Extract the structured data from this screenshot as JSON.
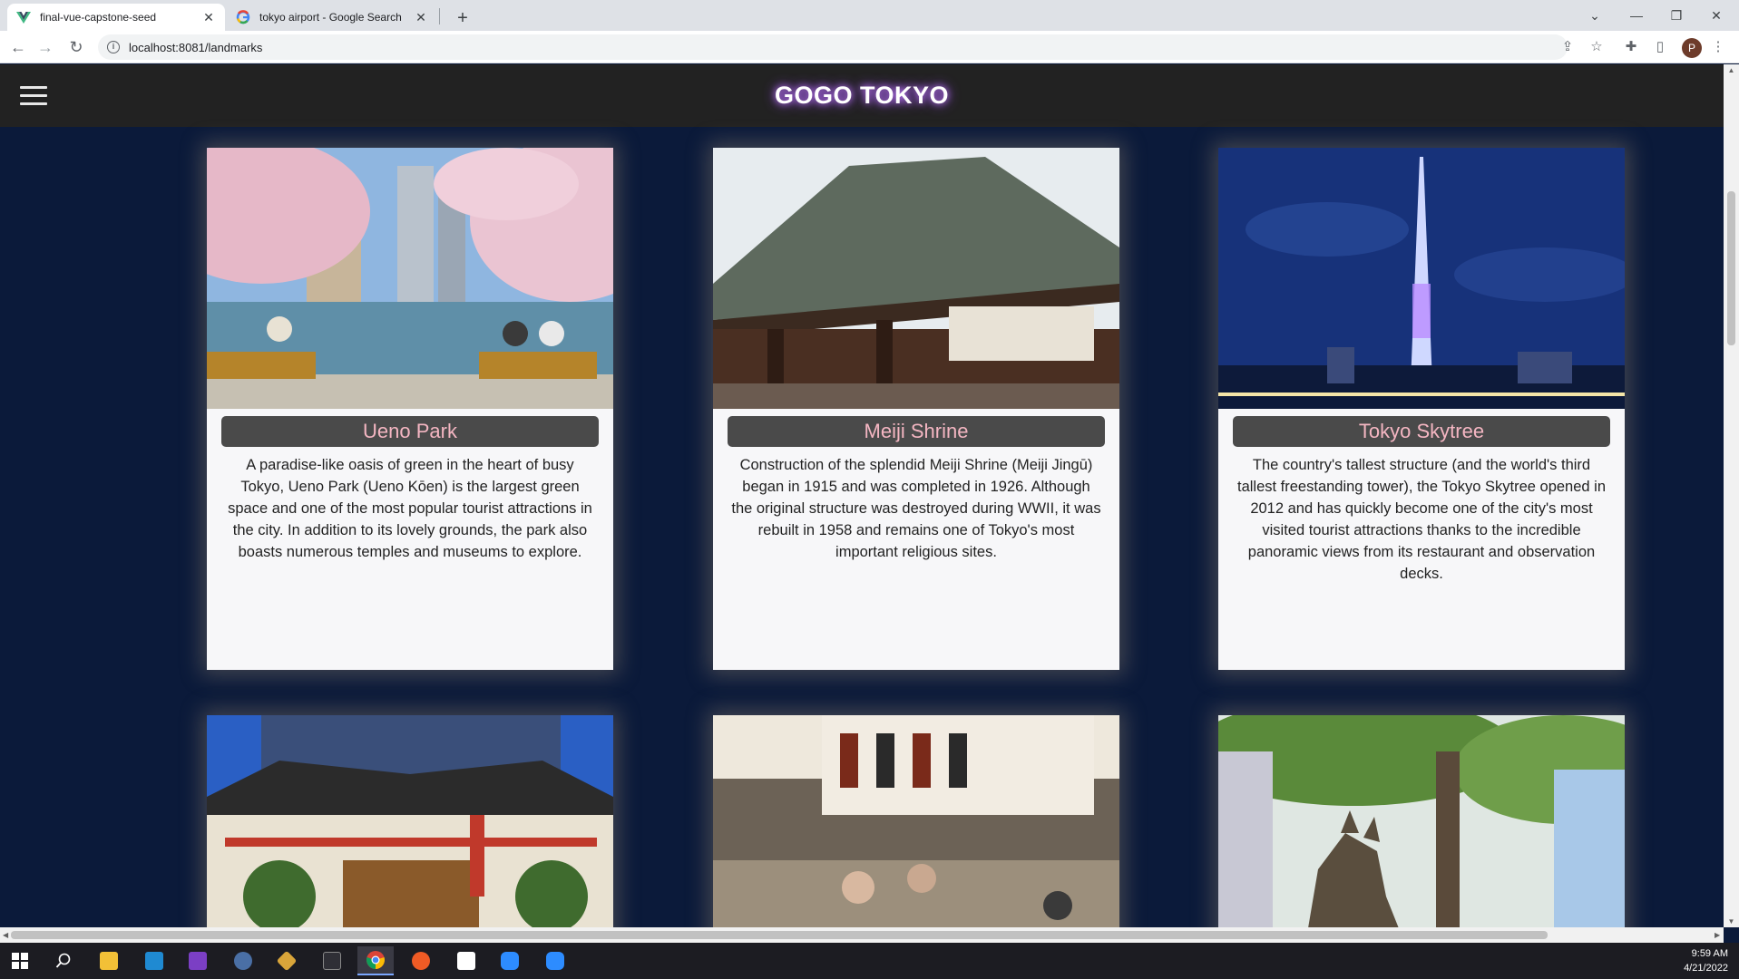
{
  "browser": {
    "tabs": [
      {
        "title": "final-vue-capstone-seed",
        "active": true,
        "favicon": "vue-icon"
      },
      {
        "title": "tokyo airport - Google Search",
        "active": false,
        "favicon": "google-icon"
      }
    ],
    "new_tab_icon": "+",
    "url": "localhost:8081/landmarks",
    "profile_initial": "P"
  },
  "app": {
    "title": "GOGO TOKYO",
    "menu_icon": "hamburger-menu-icon"
  },
  "landmarks": [
    {
      "name": "Ueno Park",
      "description": "A paradise-like oasis of green in the heart of busy Tokyo, Ueno Park (Ueno Kōen) is the largest green space and one of the most popular tourist attractions in the city. In addition to its lovely grounds, the park also boasts numerous temples and museums to explore."
    },
    {
      "name": "Meiji Shrine",
      "description": "Construction of the splendid Meiji Shrine (Meiji Jingū) began in 1915 and was completed in 1926. Although the original structure was destroyed during WWII, it was rebuilt in 1958 and remains one of Tokyo's most important religious sites."
    },
    {
      "name": "Tokyo Skytree",
      "description": "The country's tallest structure (and the world's third tallest freestanding tower), the Tokyo Skytree opened in 2012 and has quickly become one of the city's most visited tourist attractions thanks to the incredible panoramic views from its restaurant and observation decks."
    }
  ],
  "taskbar": {
    "time": "9:59 AM",
    "date": "4/21/2022"
  },
  "colors": {
    "page_bg": "#0b1a3a",
    "header_bg": "#222222",
    "name_bar": "#4a4a4a",
    "name_text": "#f4b6c2",
    "brand_glow": "#c77dff"
  }
}
